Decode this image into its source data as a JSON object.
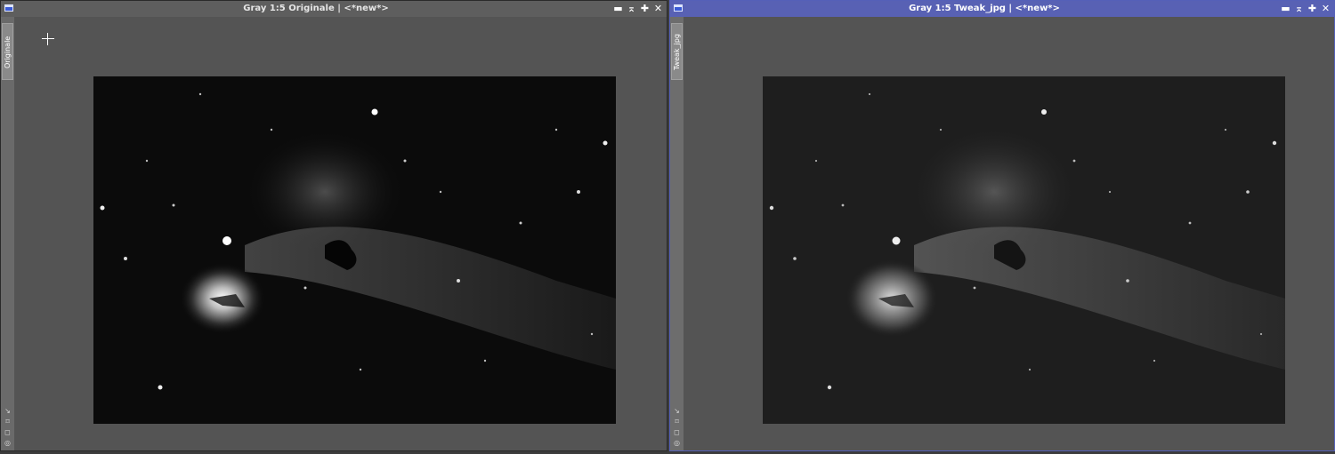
{
  "windows": [
    {
      "title": "Gray 1:5 Originale | <*new*>",
      "tab_label": "Originale",
      "controls": [
        "▬",
        "⌅",
        "✚",
        "✕"
      ],
      "side_icons": [
        "↘",
        "⌑",
        "◻",
        "◎"
      ],
      "image_label": "Horsehead and Flame Nebula (original)"
    },
    {
      "title": "Gray 1:5 Tweak_jpg | <*new*>",
      "tab_label": "Tweak_jpg",
      "controls": [
        "▬",
        "⌅",
        "✚",
        "✕"
      ],
      "side_icons": [
        "↘",
        "⌑",
        "◻",
        "◎"
      ],
      "image_label": "Horsehead and Flame Nebula (tweaked)"
    }
  ],
  "colors": {
    "active_titlebar": "#5861b4",
    "inactive_titlebar": "#5e5e5e",
    "workspace": "#545454"
  }
}
